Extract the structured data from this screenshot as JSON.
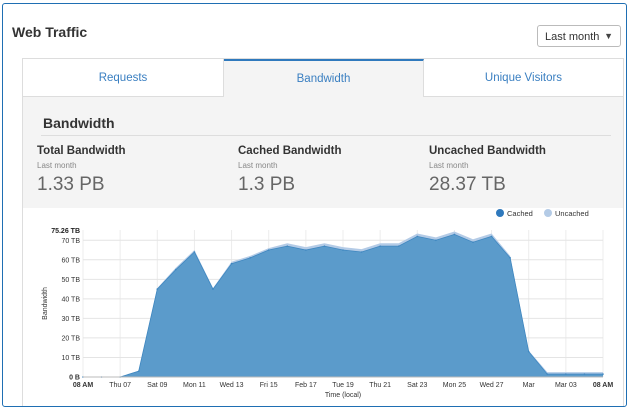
{
  "header": {
    "title": "Web Traffic",
    "range_select": "Last month"
  },
  "tabs": [
    {
      "label": "Requests",
      "active": false
    },
    {
      "label": "Bandwidth",
      "active": true
    },
    {
      "label": "Unique Visitors",
      "active": false
    }
  ],
  "section": {
    "title": "Bandwidth"
  },
  "stats": [
    {
      "label": "Total Bandwidth",
      "sub": "Last month",
      "value": "1.33 PB"
    },
    {
      "label": "Cached Bandwidth",
      "sub": "Last month",
      "value": "1.3 PB"
    },
    {
      "label": "Uncached Bandwidth",
      "sub": "Last month",
      "value": "28.37 TB"
    }
  ],
  "colors": {
    "cached": "#5b9bcb",
    "uncached": "#b4cbe6",
    "accent": "#2f79bd"
  },
  "chart_data": {
    "type": "area",
    "stacked": true,
    "ylabel": "Bandwidth",
    "xlabel": "Time (local)",
    "ymax_label": "75.26 TB",
    "yticks": [
      "0 B",
      "10 TB",
      "20 TB",
      "30 TB",
      "40 TB",
      "50 TB",
      "60 TB",
      "70 TB"
    ],
    "ylim": [
      0,
      75.26
    ],
    "xticks": [
      "08 AM",
      "Thu 07",
      "Sat 09",
      "Mon 11",
      "Wed 13",
      "Fri 15",
      "Feb 17",
      "Tue 19",
      "Thu 21",
      "Sat 23",
      "Mon 25",
      "Wed 27",
      "Mar",
      "Mar 03",
      "08 AM"
    ],
    "x": [
      "Feb 05",
      "Feb 06",
      "Feb 07",
      "Feb 08",
      "Feb 09",
      "Feb 10",
      "Feb 11",
      "Feb 12",
      "Feb 13",
      "Feb 14",
      "Feb 15",
      "Feb 16",
      "Feb 17",
      "Feb 18",
      "Feb 19",
      "Feb 20",
      "Feb 21",
      "Feb 22",
      "Feb 23",
      "Feb 24",
      "Feb 25",
      "Feb 26",
      "Feb 27",
      "Feb 28",
      "Mar 01",
      "Mar 02",
      "Mar 03",
      "Mar 04",
      "Mar 05"
    ],
    "legend_position": "top-right",
    "series": [
      {
        "name": "Cached",
        "values": [
          0,
          0,
          0,
          3,
          45,
          55,
          64,
          45,
          58,
          61,
          65,
          67,
          65,
          67,
          65,
          64,
          67,
          67,
          72,
          70,
          73,
          69,
          72,
          61,
          13,
          1.5,
          1.5,
          1.5,
          1.5
        ]
      },
      {
        "name": "Uncached",
        "values": [
          0,
          0,
          0,
          0.2,
          0.5,
          1,
          1,
          0.5,
          1,
          1,
          1,
          1.5,
          1.5,
          1.5,
          1.5,
          1.5,
          1.5,
          1.5,
          1.5,
          1.5,
          1.5,
          1.5,
          1.5,
          1,
          0.5,
          1,
          1,
          1,
          1
        ]
      }
    ]
  }
}
